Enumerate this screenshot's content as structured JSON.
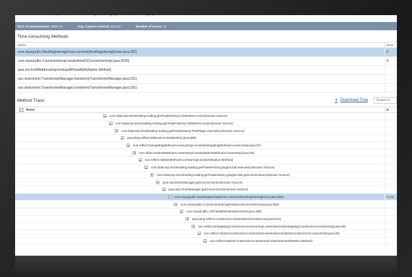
{
  "page": {
    "title": "Method Level Hotspots - stocktrading trading.getTradeHistory.jsp"
  },
  "stats": {
    "start_label": "Start of measurement:",
    "start_value": "3000 ms",
    "interval_label": "Avg. Capture Interval:",
    "interval_value": "530 ms",
    "traces_label": "Number of traces:",
    "traces_value": "21"
  },
  "time_consuming": {
    "title": "Time-consuming Methods",
    "col_name": "Name",
    "col_duration": "Dura",
    "rows": [
      {
        "name": "com.mysql.jdbc.NonRegisteringDriver.connect(NonRegisteringDriver.java:282)",
        "dur": "0"
      },
      {
        "name": "com.mysql.jdbc.ConnectionImpl.createNewIO(ConnectionImpl.java:2043)",
        "dur": "0"
      },
      {
        "name": "java.net.Inet6AddressImpl.lookupAllHostAddr(Native Method)",
        "dur": ""
      },
      {
        "name": "sun.instrument.TransformerManager.transform(TransformerManager.java:181)",
        "dur": ""
      },
      {
        "name": "sun.instrument.TransformerManager.transform(TransformerManager.java:181)",
        "dur": ""
      }
    ]
  },
  "method_trace": {
    "title": "Method Trace",
    "download_label": "Download Tree",
    "search_placeholder": "Search tr",
    "col_name": "Name",
    "col_duration": "D",
    "rows": [
      {
        "text": "com.bdacorp.stocktrading.trading.getTradeHistory.CSMarkers.run(Unknown Source)",
        "dur": ""
      },
      {
        "text": "com.bdacorp.stocktrading.trading.getTradeHistory.CSMarkers.run(Unknown Source)",
        "dur": ""
      },
      {
        "text": "com.bdacorp.stocktrading.trading.getTradeHistory.TestPlugin.execute(Unknown Source)",
        "dur": ""
      },
      {
        "text": "java.lang.reflect.Method.invoke(Method.java:599)",
        "dur": ""
      },
      {
        "text": "sun.reflect.DelegatingMethodAccessorImpl.invoke(DelegatingMethodAccessorImpl.java:37)",
        "dur": ""
      },
      {
        "text": "sun.reflect.NativeMethodAccessorImpl.invoke(NativeMethodAccessorImpl.java:45)",
        "dur": ""
      },
      {
        "text": "sun.reflect.NativeMethodAccessorImpl.invoke0(Native Method)",
        "dur": ""
      },
      {
        "text": "com.bdacorp.stocktrading.trading.getTradeHistory.plugins.DB.execute(Unknown Source)",
        "dur": ""
      },
      {
        "text": "com.bdacorp.stocktrading.trading.getTradeHistory.plugins.DB.getConnection(Unknown Source)",
        "dur": ""
      },
      {
        "text": "java.sql.DriverManager.getConnection(Unknown Source)",
        "dur": ""
      },
      {
        "text": "java.sql.DriverManager.getConnection(Unknown Source)",
        "dur": ""
      },
      {
        "text": "com.mysql.jdbc.NonRegisteringDriver.connect(NonRegisteringDriver.java:282)",
        "dur": "0 ms"
      },
      {
        "text": "com.mysql.jdbc.ConnectionImpl.getInstance(ConnectionImpl.java:302)",
        "dur": ""
      },
      {
        "text": "com.mysql.jdbc.Util.handleNewInstance(Util.java:406)",
        "dur": ""
      },
      {
        "text": "java.lang.reflect.Constructor.newInstance(Constructor.java:515)",
        "dur": ""
      },
      {
        "text": "sun.reflect.DelegatingConstructorAccessorImpl.newInstance(DelegatingConstructorAccessorImpl.java:39)",
        "dur": ""
      },
      {
        "text": "sun.reflect.NativeConstructorAccessorImpl.newInstance(NativeConstructorAccessorImpl.java:45)",
        "dur": ""
      },
      {
        "text": "sun.reflect.NativeConstructorAccessorImpl.newInstance0(Native Method)",
        "dur": ""
      }
    ]
  },
  "colors": {
    "stats_bar": "#7a8fa8",
    "selected_row": "#bcd6ee",
    "link": "#2d62a6"
  }
}
